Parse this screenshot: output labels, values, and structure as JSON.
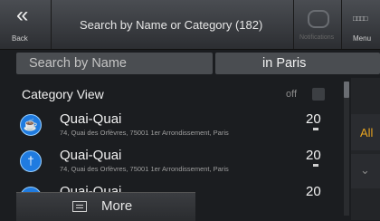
{
  "topbar": {
    "back_glyph": "«",
    "back_label": "Back",
    "title": "Search by Name or Category (182)",
    "notifications_label": "Notifications",
    "menu_glyph": "□□□□",
    "menu_label": "Menu"
  },
  "search": {
    "placeholder": "Search by Name",
    "city": "in Paris"
  },
  "category": {
    "title": "Category View",
    "toggle_state": "off"
  },
  "results": [
    {
      "icon": "coffee-icon",
      "glyph": "☕",
      "name": "Quai-Quai",
      "address": "74, Quai des Orfèvres, 75001 1er Arrondissement, Paris",
      "distance": "20"
    },
    {
      "icon": "restaurant-icon",
      "glyph": "†",
      "name": "Quai-Quai",
      "address": "74, Quai des Orfèvres, 75001 1er Arrondissement, Paris",
      "distance": "20"
    },
    {
      "icon": "location-arrow-icon",
      "glyph": "▲",
      "name": "Quai-Quai",
      "address": "",
      "distance": "20"
    }
  ],
  "sidepanel": {
    "all_label": "All",
    "collapse_glyph": "⌄"
  },
  "more": {
    "label": "More"
  },
  "colors": {
    "accent": "#e8a520",
    "icon_blue": "#1f7be0"
  }
}
